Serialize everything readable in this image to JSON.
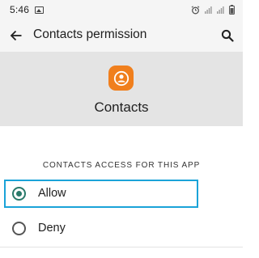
{
  "status_bar": {
    "time": "5:46",
    "icons": [
      "gallery-icon",
      "alarm-icon",
      "wifi-icon",
      "signal-icon",
      "battery-icon"
    ]
  },
  "app_bar": {
    "title": "Contacts permission",
    "back_icon": "arrow-left-icon",
    "search_icon": "search-icon"
  },
  "header": {
    "app_name": "Contacts",
    "app_icon": "contacts-icon",
    "app_icon_color": "#f07f1d"
  },
  "section": {
    "label": "CONTACTS ACCESS FOR THIS APP"
  },
  "options": [
    {
      "label": "Allow",
      "selected": true
    },
    {
      "label": "Deny",
      "selected": false
    }
  ],
  "colors": {
    "highlight": "#1aa3d8",
    "radio_selected": "#2a7a6b",
    "header_bg": "#e4e4e4"
  }
}
